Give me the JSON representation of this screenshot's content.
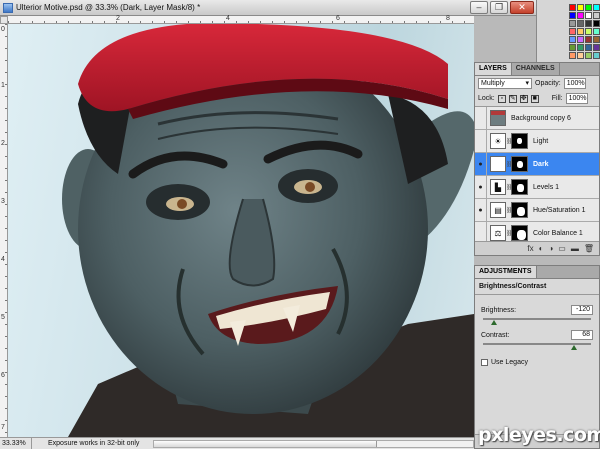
{
  "document": {
    "title": "Ulterior Motive.psd @ 33.3% (Dark, Layer Mask/8) *",
    "window_buttons": [
      "–",
      "❐",
      "✕"
    ]
  },
  "rulers": {
    "top_numbers": [
      "2",
      "4",
      "6",
      "8"
    ],
    "left_numbers": [
      "0",
      "1",
      "2",
      "3",
      "4",
      "5",
      "6",
      "7"
    ]
  },
  "statusbar": {
    "zoom": "33.33%",
    "message": "Exposure works in 32-bit only"
  },
  "swatches": {
    "colors": [
      "#ff0000",
      "#ffff00",
      "#00ff00",
      "#00ffff",
      "#0000ff",
      "#ff00ff",
      "#ffffff",
      "#cccccc",
      "#999999",
      "#666666",
      "#333333",
      "#000000",
      "#ff6666",
      "#ffcc66",
      "#ccff66",
      "#66ffcc",
      "#6699ff",
      "#cc66ff",
      "#993333",
      "#996633",
      "#669933",
      "#339966",
      "#336699",
      "#663399",
      "#ff9966",
      "#ffcc99",
      "#99cc66",
      "#66cccc"
    ]
  },
  "layers": {
    "tabs": [
      "LAYERS",
      "CHANNELS"
    ],
    "blend_mode": "Multiply",
    "opacity_label": "Opacity:",
    "opacity": "100%",
    "lock_label": "Lock:",
    "fill_label": "Fill:",
    "fill": "100%",
    "items": [
      {
        "name": "Background copy 6",
        "visible": false,
        "selected": false,
        "thumb": "photo"
      },
      {
        "name": "Light",
        "visible": false,
        "selected": false,
        "thumb": "☀"
      },
      {
        "name": "Dark",
        "visible": true,
        "selected": true,
        "thumb": "☀"
      },
      {
        "name": "Levels 1",
        "visible": true,
        "selected": false,
        "thumb": "▙"
      },
      {
        "name": "Hue/Saturation 1",
        "visible": true,
        "selected": false,
        "thumb": "▤"
      },
      {
        "name": "Color Balance 1",
        "visible": false,
        "selected": false,
        "thumb": "⚖"
      }
    ],
    "footer_icons": [
      "fx",
      "◐",
      "◑",
      "▭",
      "▬",
      "🗑"
    ]
  },
  "adjustments": {
    "tab": "ADJUSTMENTS",
    "title": "Brightness/Contrast",
    "brightness_label": "Brightness:",
    "brightness": "-120",
    "contrast_label": "Contrast:",
    "contrast": "68",
    "legacy_label": "Use Legacy",
    "brightness_level": 0.1,
    "contrast_level": 0.84
  },
  "watermark": "pxleyes.com"
}
